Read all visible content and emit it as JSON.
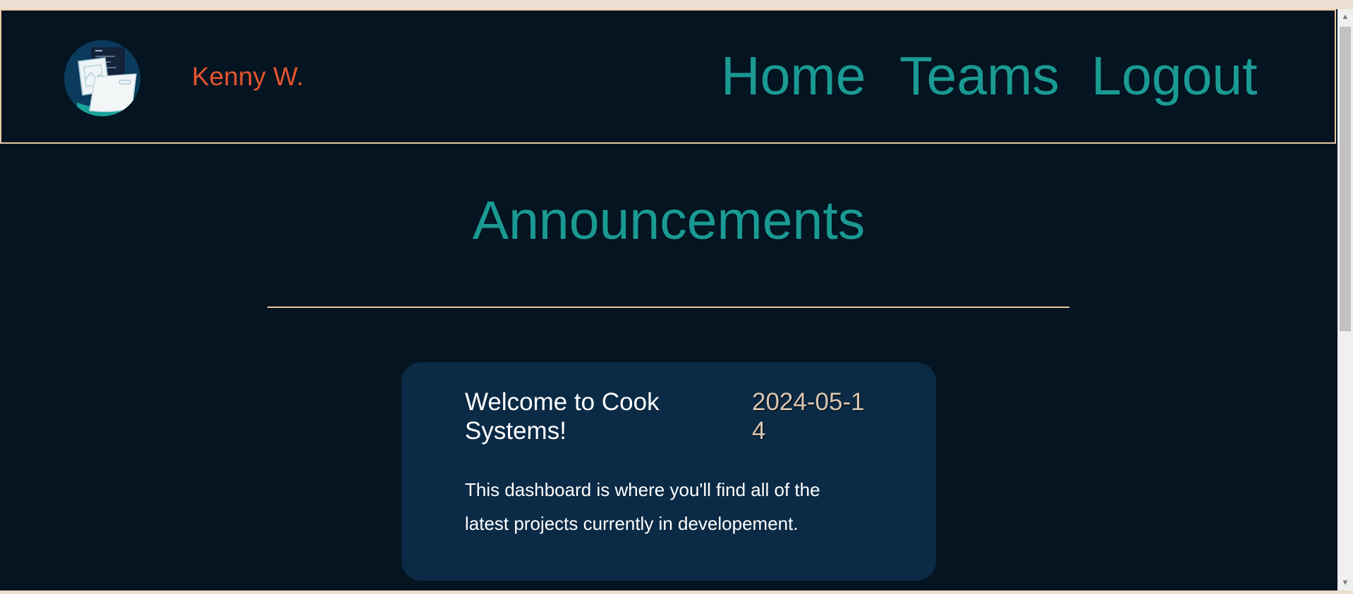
{
  "header": {
    "username": "Kenny W.",
    "logo_icon": "folder-logo-icon"
  },
  "nav": {
    "home": "Home",
    "teams": "Teams",
    "logout": "Logout"
  },
  "page": {
    "title": "Announcements"
  },
  "announcements": [
    {
      "title": "Welcome to Cook Systems!",
      "date": "2024-05-14",
      "body": "This dashboard is where you'll find all of the latest projects currently in developement."
    }
  ],
  "colors": {
    "background": "#041421",
    "accent": "#1a9a93",
    "username": "#e4542f",
    "border": "#e9c8a6",
    "card": "#0b2a45"
  }
}
